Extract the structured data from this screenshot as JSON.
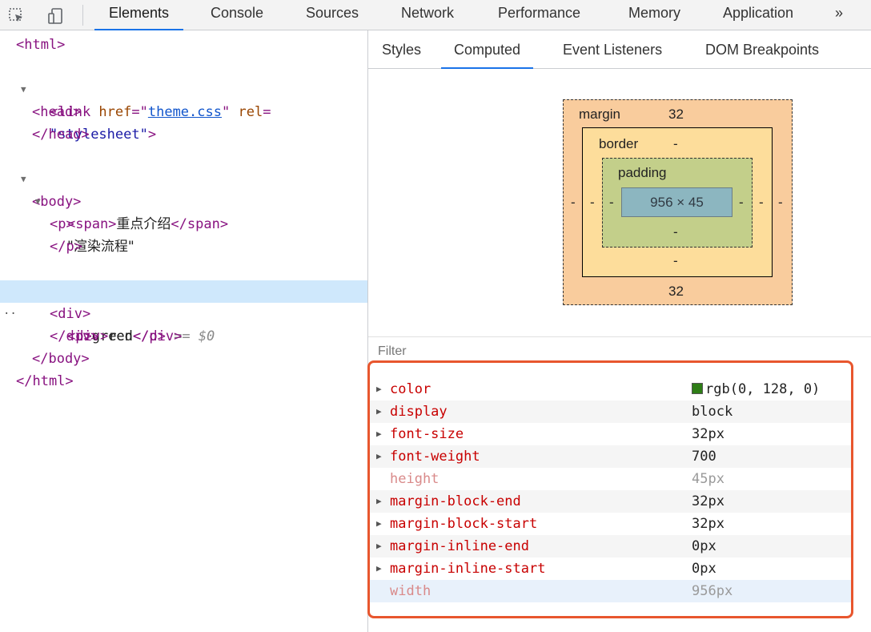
{
  "toolbar": {
    "tabs": [
      "Elements",
      "Console",
      "Sources",
      "Network",
      "Performance",
      "Memory",
      "Application"
    ],
    "more": "»"
  },
  "dom": {
    "link_href": "theme.css",
    "stylesheet": "stylesheet",
    "span_text": "重点介绍",
    "text_node": "\"渲染流程\"",
    "p_text": "green",
    "selected_marker": "== $0",
    "div_text": "red"
  },
  "subtabs": [
    "Styles",
    "Computed",
    "Event Listeners",
    "DOM Breakpoints"
  ],
  "box_model": {
    "margin_label": "margin",
    "margin_top": "32",
    "margin_bottom": "32",
    "margin_left": "-",
    "margin_right": "-",
    "border_label": "border",
    "border_top": "-",
    "border_bottom": "-",
    "border_left": "-",
    "border_right": "-",
    "padding_label": "padding",
    "padding_bottom": "-",
    "padding_left": "-",
    "padding_right": "-",
    "content": "956 × 45"
  },
  "filter_placeholder": "Filter",
  "computed": [
    {
      "name": "color",
      "value": "rgb(0, 128, 0)",
      "swatch": "#2e7d16",
      "expandable": true
    },
    {
      "name": "display",
      "value": "block",
      "expandable": true
    },
    {
      "name": "font-size",
      "value": "32px",
      "expandable": true
    },
    {
      "name": "font-weight",
      "value": "700",
      "expandable": true
    },
    {
      "name": "height",
      "value": "45px",
      "expandable": false
    },
    {
      "name": "margin-block-end",
      "value": "32px",
      "expandable": true
    },
    {
      "name": "margin-block-start",
      "value": "32px",
      "expandable": true
    },
    {
      "name": "margin-inline-end",
      "value": "0px",
      "expandable": true
    },
    {
      "name": "margin-inline-start",
      "value": "0px",
      "expandable": true
    },
    {
      "name": "width",
      "value": "956px",
      "expandable": false
    }
  ],
  "colors": {
    "accent": "#1a73e8",
    "highlight_box": "#e8562e"
  }
}
